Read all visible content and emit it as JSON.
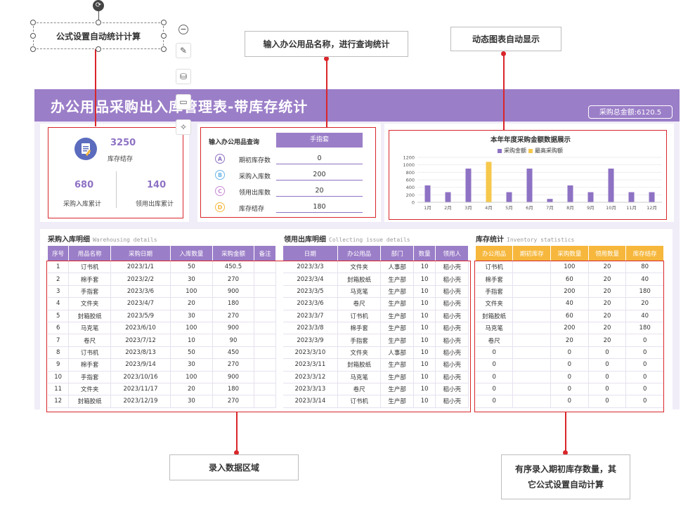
{
  "callouts": {
    "formula": "公式设置自动统计计算",
    "query": "输入办公用品名称，进行查询统计",
    "chart": "动态图表自动显示",
    "entry": "录入数据区域",
    "order_line1": "有序录入期初库存数量，其",
    "order_line2": "它公式设置自动计算"
  },
  "header": {
    "title": "办公用品采购出入库管理表-带库存统计",
    "total": "采购总金额:6120.5"
  },
  "stats": {
    "stock_value": "3250",
    "stock_label": "库存结存",
    "in_value": "680",
    "in_label": "采购入库累计",
    "out_value": "140",
    "out_label": "领用出库累计"
  },
  "query": {
    "title": "输入办公用品查询",
    "input": "手指套",
    "rows": [
      {
        "icon": "A",
        "label": "期初库存数",
        "value": "0"
      },
      {
        "icon": "B",
        "label": "采购入库数",
        "value": "200"
      },
      {
        "icon": "C",
        "label": "领用出库数",
        "value": "20"
      },
      {
        "icon": "D",
        "label": "库存结存",
        "value": "180"
      }
    ]
  },
  "chart_data": {
    "type": "bar",
    "title": "本年年度采购金额数据展示",
    "categories": [
      "1月",
      "2月",
      "3月",
      "4月",
      "5月",
      "6月",
      "7月",
      "8月",
      "9月",
      "10月",
      "11月",
      "12月"
    ],
    "series": [
      {
        "name": "采购金额",
        "values": [
          450.5,
          270,
          900,
          0,
          270,
          900,
          90,
          450,
          270,
          900,
          270,
          270
        ]
      },
      {
        "name": "最高采购额",
        "values": [
          0,
          0,
          0,
          1080,
          0,
          0,
          0,
          0,
          0,
          0,
          0,
          0
        ]
      }
    ],
    "yticks": [
      "0",
      "200",
      "400",
      "600",
      "800",
      "1000",
      "1200"
    ],
    "ylim": [
      0,
      1200
    ],
    "grid": true,
    "legend": "top",
    "colors": {
      "purchase": "#8e72c4",
      "max": "#f6c84c"
    }
  },
  "purchase": {
    "title": "采购入库明细",
    "subtitle": "Warehousing details",
    "headers": [
      "序号",
      "用品名称",
      "采购日期",
      "入库数量",
      "采购金额",
      "备注"
    ],
    "rows": [
      [
        "1",
        "订书机",
        "2023/1/1",
        "50",
        "450.5",
        ""
      ],
      [
        "2",
        "棉手套",
        "2023/2/2",
        "30",
        "270",
        ""
      ],
      [
        "3",
        "手指套",
        "2023/3/6",
        "100",
        "900",
        ""
      ],
      [
        "4",
        "文件夹",
        "2023/4/7",
        "20",
        "180",
        ""
      ],
      [
        "5",
        "封箱胶纸",
        "2023/5/9",
        "30",
        "270",
        ""
      ],
      [
        "6",
        "马克笔",
        "2023/6/10",
        "100",
        "900",
        ""
      ],
      [
        "7",
        "卷尺",
        "2023/7/12",
        "10",
        "90",
        ""
      ],
      [
        "8",
        "订书机",
        "2023/8/13",
        "50",
        "450",
        ""
      ],
      [
        "9",
        "棉手套",
        "2023/9/14",
        "30",
        "270",
        ""
      ],
      [
        "10",
        "手指套",
        "2023/10/16",
        "100",
        "900",
        ""
      ],
      [
        "11",
        "文件夹",
        "2023/11/17",
        "20",
        "180",
        ""
      ],
      [
        "12",
        "封箱胶纸",
        "2023/12/19",
        "30",
        "270",
        ""
      ]
    ]
  },
  "issue": {
    "title": "领用出库明细",
    "subtitle": "Collecting issue details",
    "headers": [
      "日期",
      "办公用品",
      "部门",
      "数量",
      "领用人"
    ],
    "rows": [
      [
        "2023/3/3",
        "文件夹",
        "人事部",
        "10",
        "稻小壳"
      ],
      [
        "2023/3/4",
        "封箱胶纸",
        "生产部",
        "10",
        "稻小壳"
      ],
      [
        "2023/3/5",
        "马克笔",
        "生产部",
        "10",
        "稻小壳"
      ],
      [
        "2023/3/6",
        "卷尺",
        "生产部",
        "10",
        "稻小壳"
      ],
      [
        "2023/3/7",
        "订书机",
        "生产部",
        "10",
        "稻小壳"
      ],
      [
        "2023/3/8",
        "棉手套",
        "生产部",
        "10",
        "稻小壳"
      ],
      [
        "2023/3/9",
        "手指套",
        "生产部",
        "10",
        "稻小壳"
      ],
      [
        "2023/3/10",
        "文件夹",
        "人事部",
        "10",
        "稻小壳"
      ],
      [
        "2023/3/11",
        "封箱胶纸",
        "生产部",
        "10",
        "稻小壳"
      ],
      [
        "2023/3/12",
        "马克笔",
        "生产部",
        "10",
        "稻小壳"
      ],
      [
        "2023/3/13",
        "卷尺",
        "生产部",
        "10",
        "稻小壳"
      ],
      [
        "2023/3/14",
        "订书机",
        "生产部",
        "10",
        "稻小壳"
      ]
    ]
  },
  "inventory": {
    "title": "库存统计",
    "subtitle": "Inventory statistics",
    "headers": [
      "办公用品",
      "期初库存",
      "采购数量",
      "领用数量",
      "库存结存"
    ],
    "rows": [
      [
        "订书机",
        "",
        "100",
        "20",
        "80"
      ],
      [
        "棉手套",
        "",
        "60",
        "20",
        "40"
      ],
      [
        "手指套",
        "",
        "200",
        "20",
        "180"
      ],
      [
        "文件夹",
        "",
        "40",
        "20",
        "20"
      ],
      [
        "封箱胶纸",
        "",
        "60",
        "20",
        "40"
      ],
      [
        "马克笔",
        "",
        "200",
        "20",
        "180"
      ],
      [
        "卷尺",
        "",
        "20",
        "20",
        "0"
      ],
      [
        "0",
        "",
        "0",
        "0",
        "0"
      ],
      [
        "0",
        "",
        "0",
        "0",
        "0"
      ],
      [
        "0",
        "",
        "0",
        "0",
        "0"
      ],
      [
        "0",
        "",
        "0",
        "0",
        "0"
      ],
      [
        "0",
        "",
        "0",
        "0",
        "0"
      ]
    ]
  }
}
